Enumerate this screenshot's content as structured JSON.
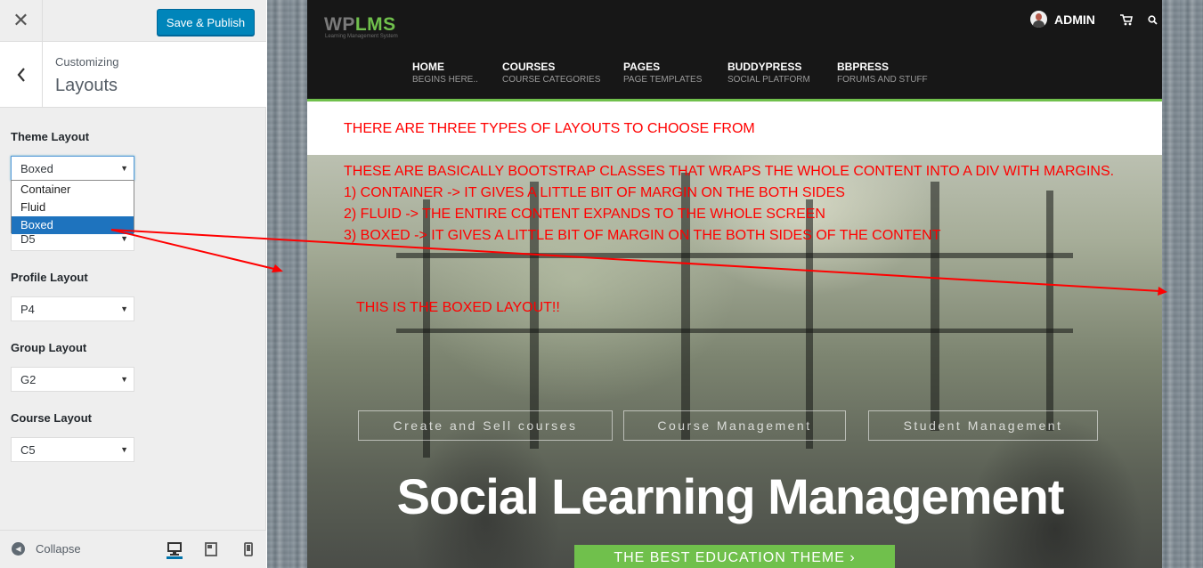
{
  "customizer": {
    "close_label": "✕",
    "publish_label": "Save & Publish",
    "customizing_label": "Customizing",
    "section_title": "Layouts",
    "controls": {
      "theme_layout": {
        "label": "Theme Layout",
        "value": "Boxed",
        "options": [
          "Container",
          "Fluid",
          "Boxed"
        ]
      },
      "directory_layout": {
        "value": "D5"
      },
      "profile_layout": {
        "label": "Profile Layout",
        "value": "P4"
      },
      "group_layout": {
        "label": "Group Layout",
        "value": "G2"
      },
      "course_layout": {
        "label": "Course Layout",
        "value": "C5"
      }
    },
    "footer": {
      "collapse_label": "Collapse"
    }
  },
  "site": {
    "logo_wp": "WP",
    "logo_lms": "LMS",
    "logo_tagline": "Learning Management System",
    "admin_label": "ADMIN",
    "nav": [
      {
        "label": "HOME",
        "sub": "BEGINS HERE.."
      },
      {
        "label": "COURSES",
        "sub": "COURSE CATEGORIES"
      },
      {
        "label": "PAGES",
        "sub": "PAGE TEMPLATES"
      },
      {
        "label": "BUDDYPRESS",
        "sub": "SOCIAL PLATFORM"
      },
      {
        "label": "BBPRESS",
        "sub": "FORUMS AND STUFF"
      }
    ],
    "hero_buttons": [
      "Create and Sell courses",
      "Course Management",
      "Student Management"
    ],
    "hero_title": "Social Learning Management",
    "cta_label": "THE BEST EDUCATION THEME ›"
  },
  "annotations": {
    "heading": "THERE ARE THREE TYPES OF LAYOUTS TO CHOOSE FROM",
    "line1": "THESE ARE BASICALLY BOOTSTRAP CLASSES THAT WRAPS THE WHOLE CONTENT INTO A DIV WITH MARGINS.",
    "line2": "1) CONTAINER -> IT GIVES A LITTLE BIT OF MARGIN ON THE BOTH SIDES",
    "line3": "2) FLUID -> THE ENTIRE CONTENT EXPANDS TO THE WHOLE SCREEN",
    "line4": "3) BOXED -> IT GIVES A LITTLE BIT OF MARGIN ON THE BOTH SIDES OF THE CONTENT",
    "boxed_note": "THIS IS THE BOXED LAYOUT!!"
  },
  "colors": {
    "accent": "#0085ba",
    "brand_green": "#70c04c",
    "annotation_red": "#ff0000"
  }
}
